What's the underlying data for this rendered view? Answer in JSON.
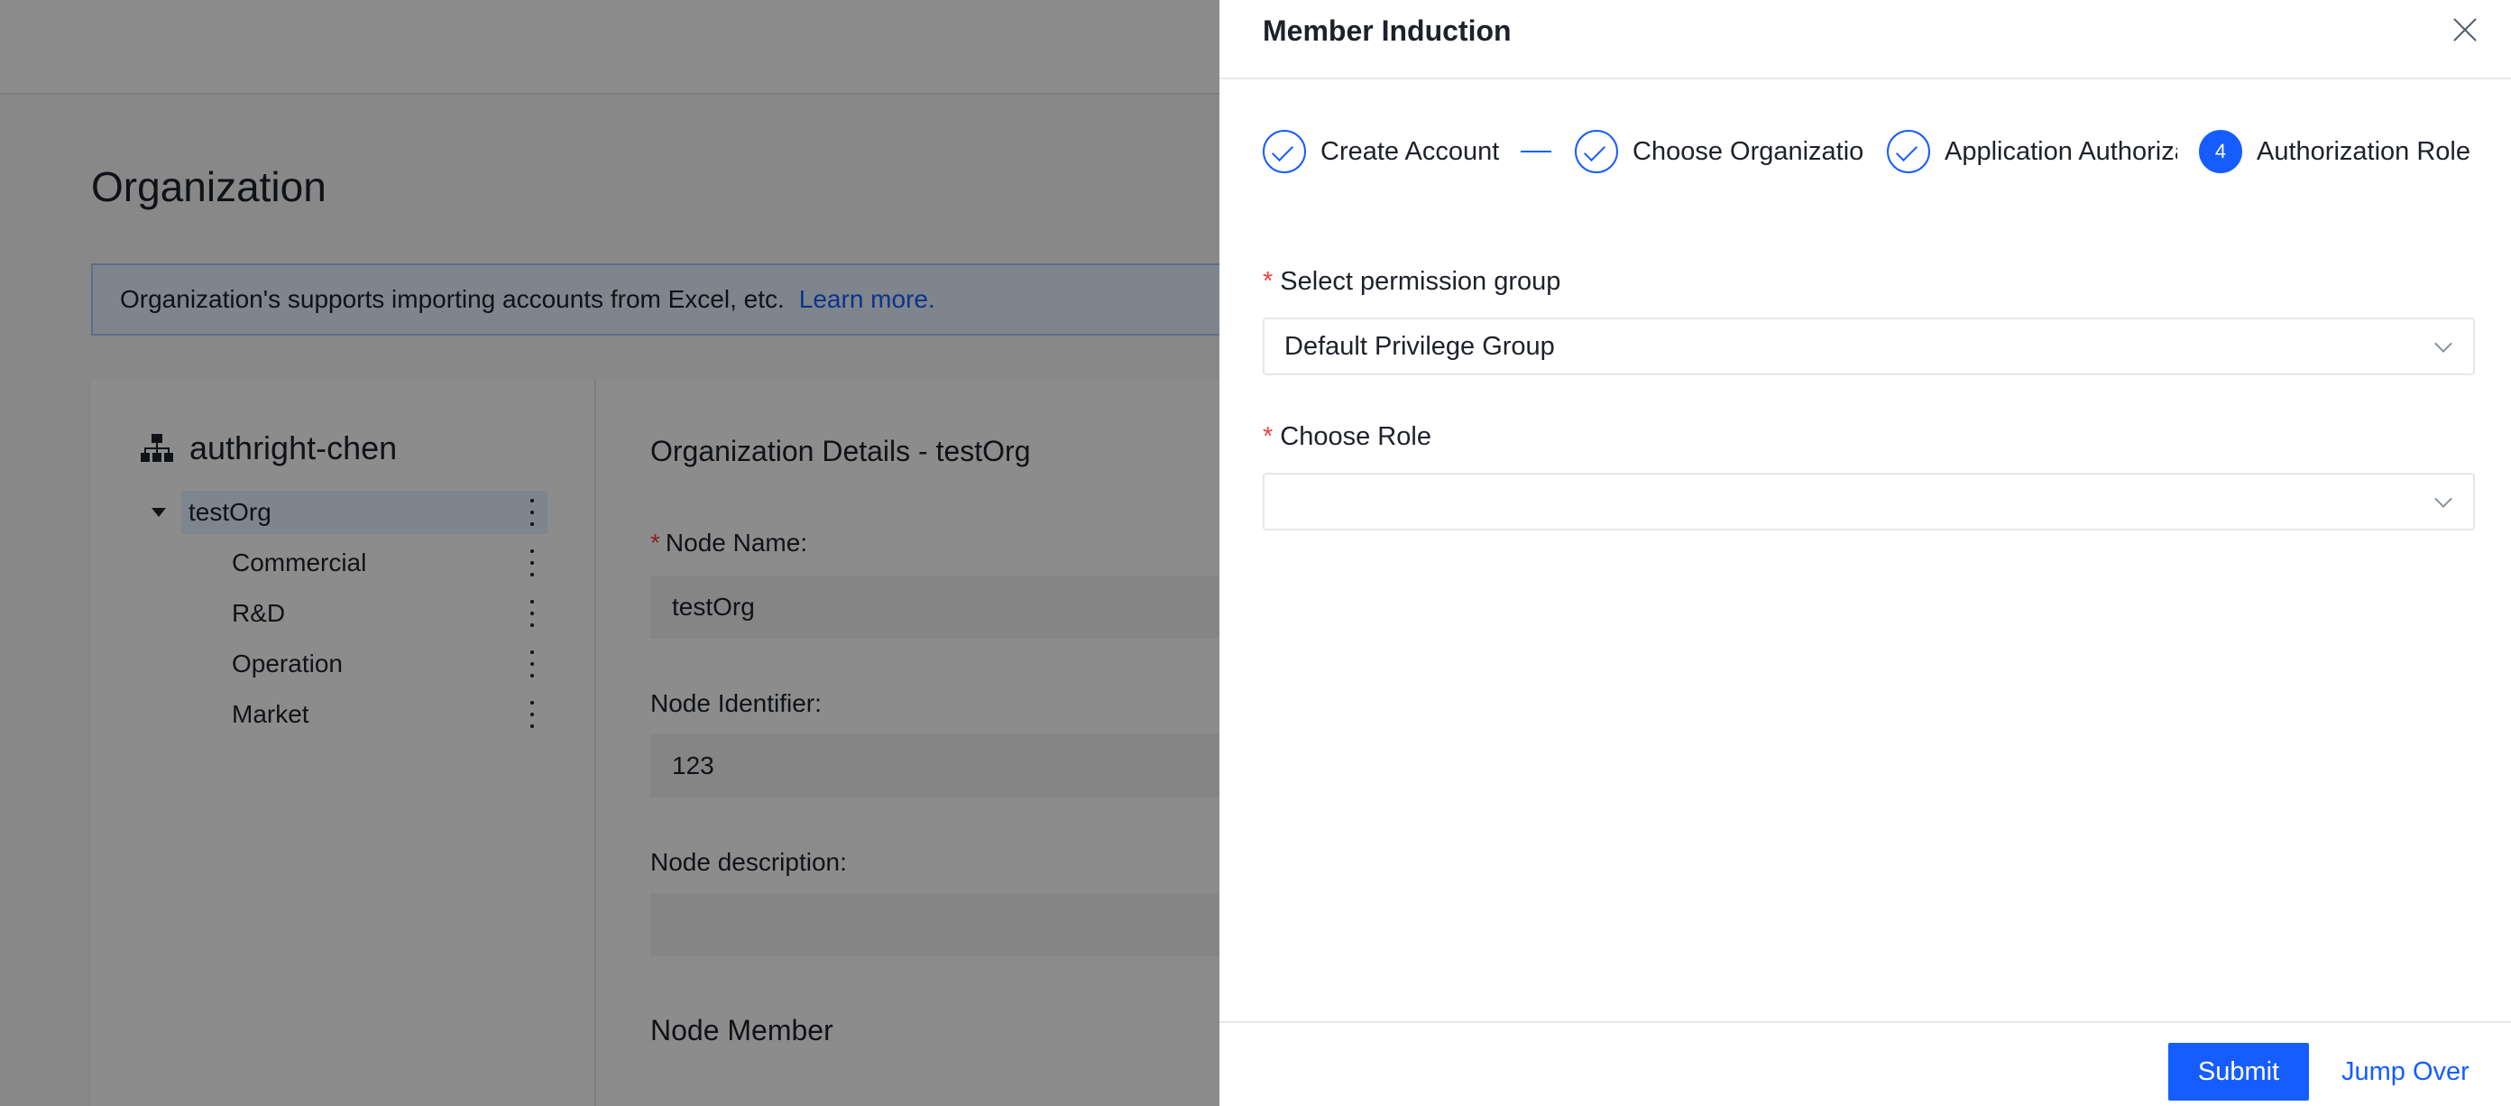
{
  "background": {
    "page_title": "Organization",
    "info_banner": {
      "text": "Organization's supports importing accounts from Excel, etc.",
      "link": "Learn more."
    },
    "tree": {
      "root": "authright-chen",
      "selected": "testOrg",
      "children": [
        "Commercial",
        "R&D",
        "Operation",
        "Market"
      ]
    },
    "details": {
      "title": "Organization Details - testOrg",
      "node_name_label": "Node Name:",
      "node_name_value": "testOrg",
      "node_identifier_label": "Node Identifier:",
      "node_identifier_value": "123",
      "node_description_label": "Node description:",
      "node_description_value": "",
      "node_member_title": "Node Member"
    }
  },
  "drawer": {
    "title": "Member Induction",
    "steps": [
      {
        "label": "Create Account",
        "status": "done"
      },
      {
        "label": "Choose Organization",
        "status": "done"
      },
      {
        "label": "Application Authorization",
        "status": "done"
      },
      {
        "label": "Authorization Role",
        "status": "active",
        "number": "4"
      }
    ],
    "permission_group": {
      "label": "Select permission group",
      "value": "Default Privilege Group"
    },
    "role": {
      "label": "Choose Role",
      "value": ""
    },
    "footer": {
      "submit": "Submit",
      "jump_over": "Jump Over"
    }
  },
  "colors": {
    "primary": "#165dff",
    "required": "#f53f3f",
    "overlay": "rgba(0,0,0,0.45)"
  }
}
